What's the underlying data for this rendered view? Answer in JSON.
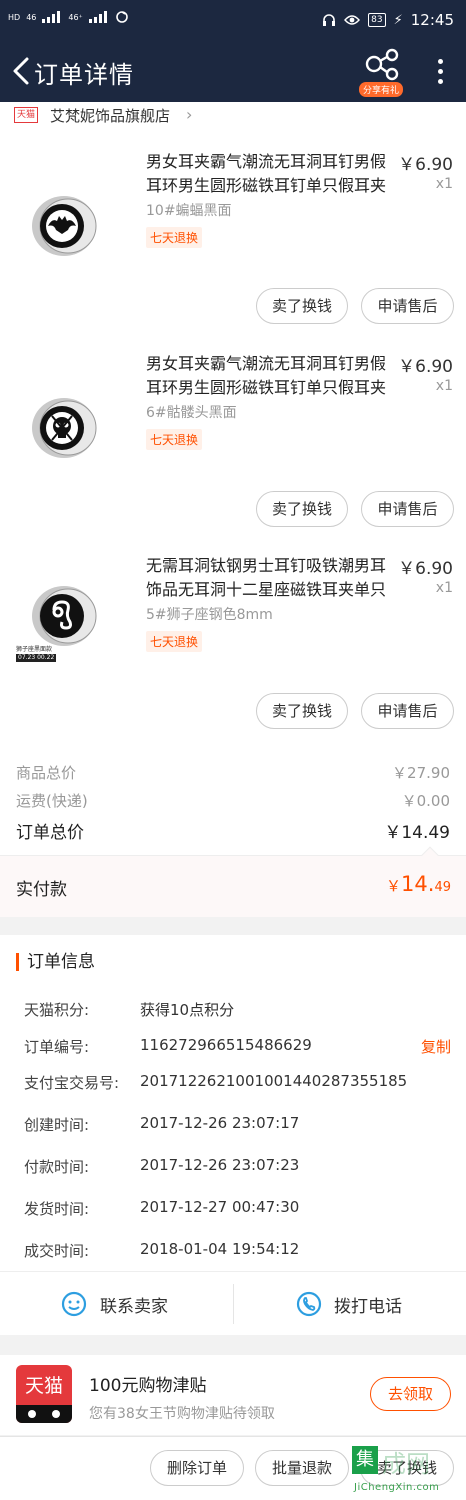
{
  "status_bar": {
    "left_tags": [
      "HD",
      "46",
      "46⁺"
    ],
    "battery": "83",
    "time": "12:45"
  },
  "nav": {
    "title": "订单详情",
    "share_badge": "分享有礼"
  },
  "shop": {
    "badge": "天猫",
    "name": "艾梵妮饰品旗舰店"
  },
  "items": [
    {
      "title": "男女耳夹霸气潮流无耳洞耳钉男假耳环男生圆形磁铁耳钉单只假耳夹",
      "price": "￥6.90",
      "qty": "x1",
      "sku": "10#蝙蝠黑面",
      "tag": "七天退换",
      "btn_sell": "卖了换钱",
      "btn_after": "申请售后",
      "icon": "bat-icon"
    },
    {
      "title": "男女耳夹霸气潮流无耳洞耳钉男假耳环男生圆形磁铁耳钉单只假耳夹",
      "price": "￥6.90",
      "qty": "x1",
      "sku": "6#骷髅头黑面",
      "tag": "七天退换",
      "btn_sell": "卖了换钱",
      "btn_after": "申请售后",
      "icon": "skull-icon"
    },
    {
      "title": "无需耳洞钛钢男士耳钉吸铁潮男耳饰品无耳洞十二星座磁铁耳夹单只",
      "price": "￥6.90",
      "qty": "x1",
      "sku": "5#狮子座钢色8mm",
      "tag": "七天退换",
      "btn_sell": "卖了换钱",
      "btn_after": "申请售后",
      "icon": "leo-icon",
      "thumb_caption": "狮子座黑面款",
      "thumb_date": "07.23 00.22"
    }
  ],
  "summary": {
    "goods_label": "商品总价",
    "goods_value": "￥27.90",
    "shipping_label": "运费(快递)",
    "shipping_value": "￥0.00",
    "total_label": "订单总价",
    "total_value": "￥14.49",
    "paid_label": "实付款",
    "paid_currency": "￥",
    "paid_int": "14.",
    "paid_dec": "49"
  },
  "order_info": {
    "title": "订单信息",
    "rows": [
      {
        "k": "天猫积分:",
        "v": "获得10点积分"
      },
      {
        "k": "订单编号:",
        "v": "116272966515486629",
        "action": "复制"
      },
      {
        "k": "支付宝交易号:",
        "v": "2017122621001001440287355185"
      },
      {
        "k": "创建时间:",
        "v": "2017-12-26 23:07:17"
      },
      {
        "k": "付款时间:",
        "v": "2017-12-26 23:07:23"
      },
      {
        "k": "发货时间:",
        "v": "2017-12-27 00:47:30"
      },
      {
        "k": "成交时间:",
        "v": "2018-01-04 19:54:12"
      }
    ]
  },
  "contact": {
    "seller": "联系卖家",
    "phone": "拨打电话"
  },
  "promo": {
    "logo": "天猫",
    "title": "100元购物津贴",
    "subtitle": "您有38女王节购物津贴待领取",
    "button": "去领取"
  },
  "bottom": {
    "delete": "删除订单",
    "refund": "批量退款",
    "sell": "卖了换钱"
  },
  "watermark": {
    "box": "集",
    "text": "成网",
    "url": "JiChengXin.com"
  },
  "colors": {
    "header_bg": "#1c2840",
    "accent": "#ff5000",
    "tmall_red": "#e4393c"
  }
}
